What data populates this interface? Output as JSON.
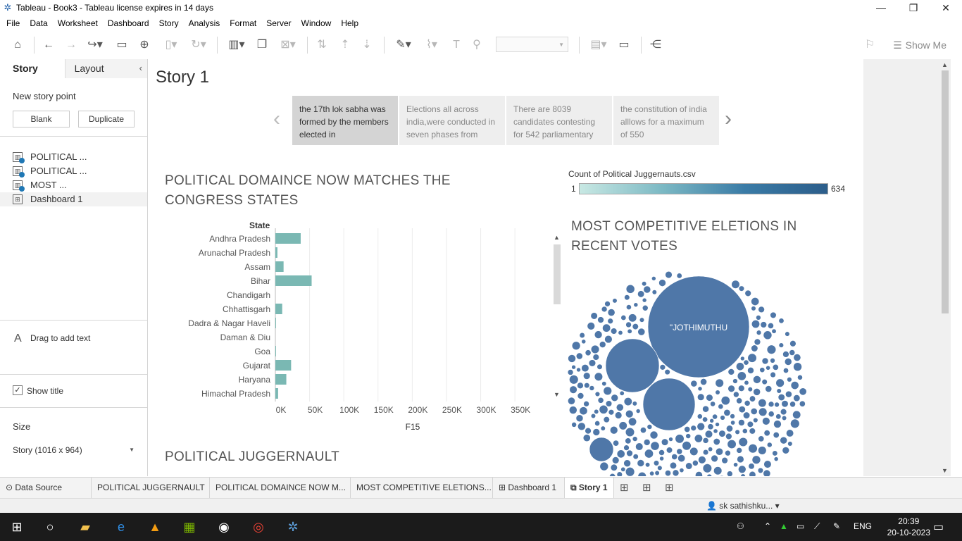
{
  "window": {
    "title": "Tableau - Book3 - Tableau license expires in 14 days"
  },
  "menu": [
    "File",
    "Data",
    "Worksheet",
    "Dashboard",
    "Story",
    "Analysis",
    "Format",
    "Server",
    "Window",
    "Help"
  ],
  "toolbar": {
    "show_me": "Show Me"
  },
  "left_panel": {
    "tabs": [
      "Story",
      "Layout"
    ],
    "new_story_point": "New story point",
    "blank_button": "Blank",
    "duplicate_button": "Duplicate",
    "sheets": [
      {
        "label": "POLITICAL ...",
        "type": "worksheet"
      },
      {
        "label": "POLITICAL ...",
        "type": "worksheet"
      },
      {
        "label": "MOST ...",
        "type": "worksheet"
      },
      {
        "label": "Dashboard 1",
        "type": "dashboard"
      }
    ],
    "drag_text": "Drag to add text",
    "show_title": "Show title",
    "size_label": "Size",
    "size_value": "Story (1016 x 964)"
  },
  "story": {
    "title": "Story 1",
    "points": [
      "the 17th lok sabha was formed by the members elected in",
      "Elections all across india,were conducted in seven phases from",
      "There are 8039 candidates contesting for 542 parliamentary",
      "the constitution of india alllows for a maximum of 550"
    ]
  },
  "dashboard": {
    "bar_title": "POLITICAL DOMAINCE NOW MATCHES THE CONGRESS STATES",
    "bubble_title": "MOST COMPETITIVE ELETIONS IN RECENT VOTES",
    "third_title": "POLITICAL JUGGERNAULT",
    "state_header": "State",
    "legend": {
      "title": "Count of Political Juggernauts.csv",
      "min": "1",
      "max": "634"
    },
    "bubble_label": "\"JOTHIMUTHU"
  },
  "chart_data": {
    "type": "bar",
    "title": "POLITICAL DOMAINCE NOW MATCHES THE CONGRESS STATES",
    "xlabel": "F15",
    "ylabel": "State",
    "categories": [
      "Andhra Pradesh",
      "Arunachal Pradesh",
      "Assam",
      "Bihar",
      "Chandigarh",
      "Chhattisgarh",
      "Dadra & Nagar Haveli",
      "Daman & Diu",
      "Goa",
      "Gujarat",
      "Haryana",
      "Himachal Pradesh"
    ],
    "values": [
      37000,
      3000,
      12000,
      53000,
      0,
      10000,
      1000,
      0,
      1000,
      23000,
      16000,
      4000
    ],
    "xlim": [
      0,
      390000
    ],
    "x_ticks": [
      "0K",
      "50K",
      "100K",
      "150K",
      "200K",
      "250K",
      "300K",
      "350K"
    ],
    "bar_color": "#7ab8b3",
    "grid": true
  },
  "sheet_tabs": [
    "Data Source",
    "POLITICAL JUGGERNAULT",
    "POLITICAL DOMAINCE NOW M...",
    "MOST COMPETITIVE ELETIONS...",
    "Dashboard 1",
    "Story 1"
  ],
  "status": {
    "user": "sk sathishku..."
  },
  "taskbar": {
    "lang": "ENG",
    "time": "20:39",
    "date": "20-10-2023"
  }
}
